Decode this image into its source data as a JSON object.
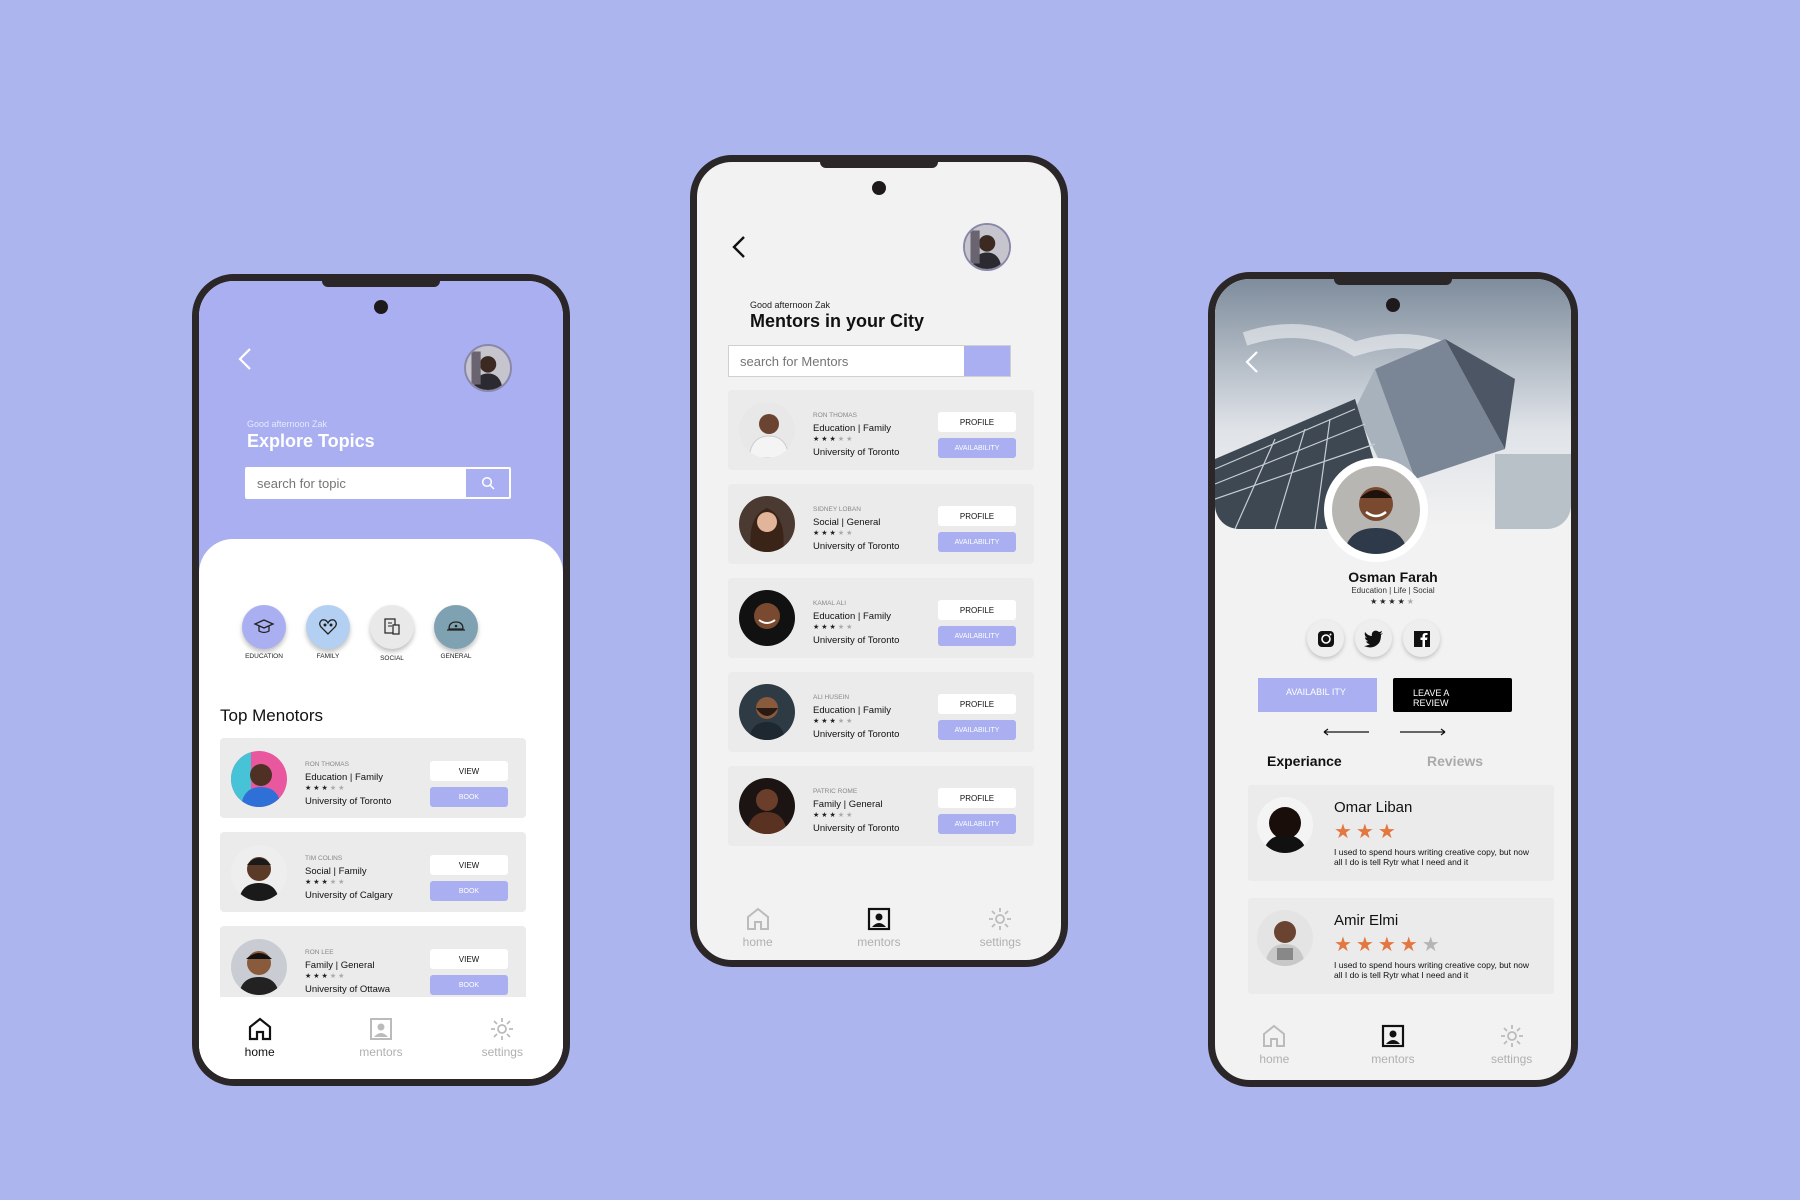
{
  "screen1": {
    "greeting": "Good afternoon Zak",
    "title": "Explore Topics",
    "search_placeholder": "search for topic",
    "topics": [
      "EDUCATION",
      "FAMILY",
      "SOCIAL",
      "GENERAL"
    ],
    "section_title": "Top Menotors",
    "view_label": "VIEW",
    "book_label": "BOOK",
    "mentors": [
      {
        "name": "RON THOMAS",
        "tags": "Education | Family",
        "uni": "University of Toronto",
        "stars": 3
      },
      {
        "name": "TIM COLINS",
        "tags": "Social | Family",
        "uni": "University of Calgary",
        "stars": 3
      },
      {
        "name": "RON LEE",
        "tags": "Family | General",
        "uni": "University of Ottawa",
        "stars": 3
      }
    ],
    "nav": [
      "home",
      "mentors",
      "settings"
    ]
  },
  "screen2": {
    "greeting": "Good afternoon Zak",
    "title": "Mentors in your City",
    "search_placeholder": "search for Mentors",
    "profile_label": "PROFILE",
    "availability_label": "AVAILABILITY",
    "mentors": [
      {
        "name": "RON THOMAS",
        "tags": "Education | Family",
        "uni": "University of Toronto",
        "stars": 3
      },
      {
        "name": "SIDNEY  LOBAN",
        "tags": "Social | General",
        "uni": "University of Toronto",
        "stars": 3
      },
      {
        "name": "KAMAL ALI",
        "tags": "Education | Family",
        "uni": "University of Toronto",
        "stars": 3
      },
      {
        "name": "ALI HUSEIN",
        "tags": "Education | Family",
        "uni": "University of Toronto",
        "stars": 3
      },
      {
        "name": "PATRIC ROME",
        "tags": "Family | General",
        "uni": "University of Toronto",
        "stars": 3
      }
    ],
    "nav": [
      "home",
      "mentors",
      "settings"
    ]
  },
  "screen3": {
    "name": "Osman Farah",
    "tags": "Education | Life | Social",
    "stars": 4,
    "availability_label": "AVAILABIL ITY",
    "review_label": "LEAVE A REVIEW",
    "tab_experience": "Experiance",
    "tab_reviews": "Reviews",
    "reviews": [
      {
        "name": "Omar Liban",
        "stars": 3,
        "max": 3,
        "text": "I used to spend hours writing creative copy, but now all I do is tell Rytr what I need and it"
      },
      {
        "name": "Amir Elmi",
        "stars": 4,
        "max": 5,
        "text": "I used to spend hours writing creative copy, but now all I do is tell Rytr what I need and it"
      }
    ],
    "nav": [
      "home",
      "mentors",
      "settings"
    ]
  },
  "colors": {
    "background": "#adb5ef",
    "accent": "#a9aff0",
    "star": "#e2773f"
  }
}
